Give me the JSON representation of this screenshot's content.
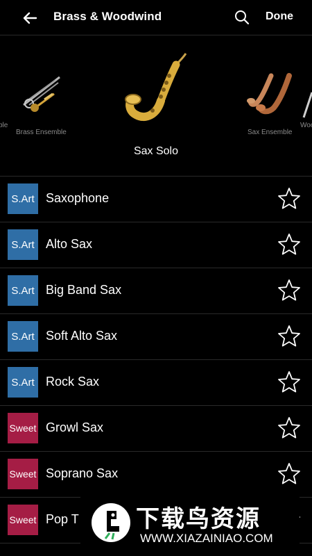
{
  "header": {
    "title": "Brass & Woodwind",
    "done_label": "Done"
  },
  "carousel": {
    "left_label": "Brass Ensemble",
    "center_label": "Sax Solo",
    "right_label": "Sax Ensemble",
    "far_left_fragment": "ble",
    "far_right_fragment": "Woo"
  },
  "instruments": [
    {
      "badge": "S.Art",
      "badge_color": "#2f6ea6",
      "name": "Saxophone"
    },
    {
      "badge": "S.Art",
      "badge_color": "#2f6ea6",
      "name": "Alto Sax"
    },
    {
      "badge": "S.Art",
      "badge_color": "#2f6ea6",
      "name": "Big Band Sax"
    },
    {
      "badge": "S.Art",
      "badge_color": "#2f6ea6",
      "name": "Soft Alto Sax"
    },
    {
      "badge": "S.Art",
      "badge_color": "#2f6ea6",
      "name": "Rock Sax"
    },
    {
      "badge": "Sweet",
      "badge_color": "#a51d45",
      "name": "Growl Sax"
    },
    {
      "badge": "Sweet",
      "badge_color": "#a51d45",
      "name": "Soprano Sax"
    },
    {
      "badge": "Sweet",
      "badge_color": "#a51d45",
      "name": "Pop T"
    }
  ],
  "watermark": {
    "title": "下载鸟资源",
    "url": "WWW.XIAZAINIAO.COM"
  }
}
